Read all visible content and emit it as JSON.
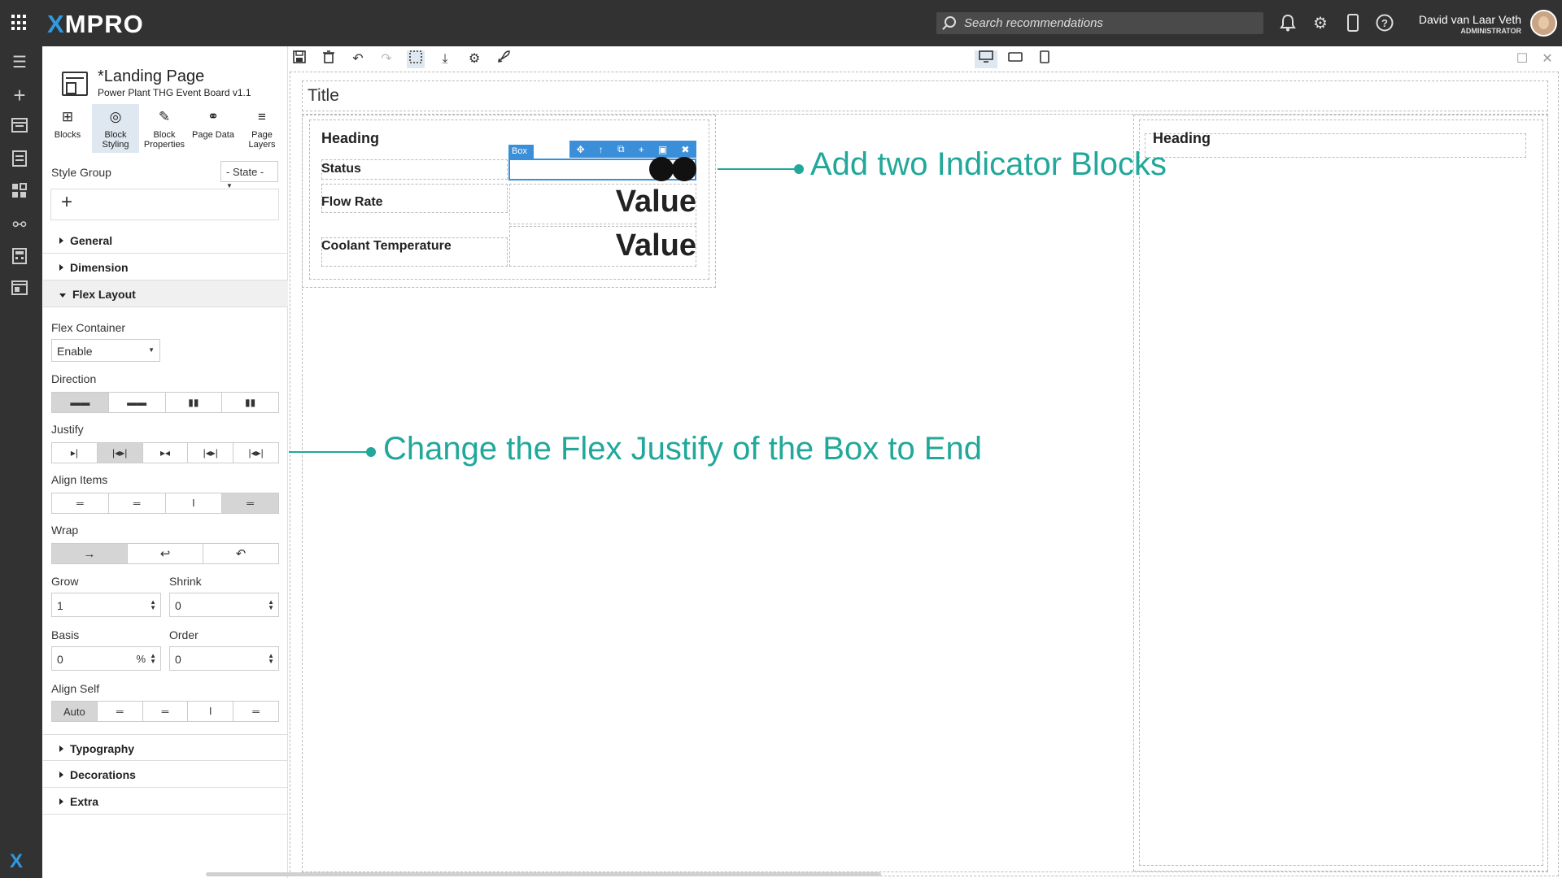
{
  "app": {
    "logo_prefix": "X",
    "logo_rest": "MPRO"
  },
  "search": {
    "placeholder": "Search recommendations"
  },
  "user": {
    "name": "David van Laar Veth",
    "role": "ADMINISTRATOR"
  },
  "page": {
    "title": "*Landing Page",
    "subtitle": "Power Plant THG Event Board v1.1"
  },
  "panel_tabs": [
    {
      "icon": "blocks-icon",
      "glyph": "⊞",
      "label": "Blocks"
    },
    {
      "icon": "palette-icon",
      "glyph": "◎",
      "label": "Block\nStyling"
    },
    {
      "icon": "pencil-icon",
      "glyph": "✎",
      "label": "Block\nProperties"
    },
    {
      "icon": "link-icon",
      "glyph": "⚭",
      "label": "Page Data"
    },
    {
      "icon": "layers-icon",
      "glyph": "≡",
      "label": "Page\nLayers"
    }
  ],
  "style_group": {
    "label": "Style Group",
    "state": "- State -",
    "add": "+"
  },
  "sections": {
    "general": "General",
    "dimension": "Dimension",
    "flex_layout": "Flex Layout",
    "typography": "Typography",
    "decorations": "Decorations",
    "extra": "Extra"
  },
  "flex": {
    "container_label": "Flex Container",
    "container_value": "Enable",
    "direction_label": "Direction",
    "justify_label": "Justify",
    "align_items_label": "Align Items",
    "wrap_label": "Wrap",
    "grow_label": "Grow",
    "grow_value": "1",
    "shrink_label": "Shrink",
    "shrink_value": "0",
    "basis_label": "Basis",
    "basis_value": "0",
    "basis_unit": "%",
    "order_label": "Order",
    "order_value": "0",
    "align_self_label": "Align Self",
    "align_self_auto": "Auto"
  },
  "canvas": {
    "title": "Title",
    "heading_left": "Heading",
    "heading_right": "Heading",
    "status_label": "Status",
    "flow_label": "Flow Rate",
    "flow_value": "Value",
    "coolant_label": "Coolant Temperature",
    "coolant_value": "Value",
    "box_tag": "Box"
  },
  "annotations": {
    "indicator": "Add two Indicator Blocks",
    "justify": "Change the Flex Justify of the Box to End"
  },
  "colors": {
    "accent": "#21a89a",
    "selection": "#3a8fd8",
    "topbar": "#323232"
  }
}
